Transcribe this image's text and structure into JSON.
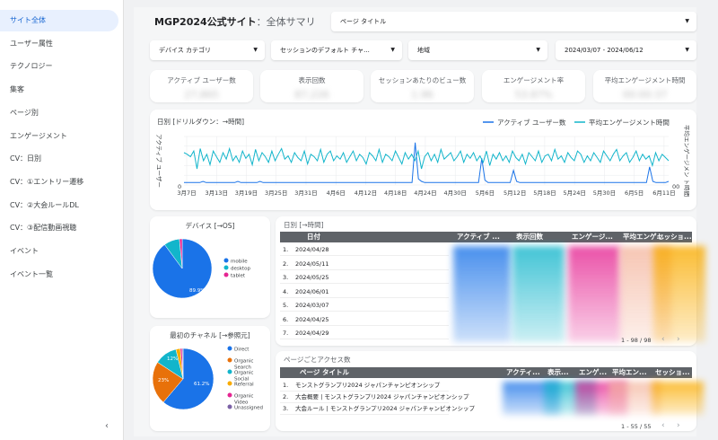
{
  "sidebar": {
    "items": [
      {
        "label": "サイト全体",
        "active": true
      },
      {
        "label": "ユーザー属性",
        "active": false
      },
      {
        "label": "テクノロジー",
        "active": false
      },
      {
        "label": "集客",
        "active": false
      },
      {
        "label": "ページ別",
        "active": false
      },
      {
        "label": "エンゲージメント",
        "active": false
      },
      {
        "label": "CV：日別",
        "active": false
      },
      {
        "label": "CV：①エントリー遷移",
        "active": false
      },
      {
        "label": "CV：②大会ルールDL",
        "active": false
      },
      {
        "label": "CV：③配信動画視聴",
        "active": false
      },
      {
        "label": "イベント",
        "active": false
      },
      {
        "label": "イベント一覧",
        "active": false
      }
    ],
    "collapse_icon": "chevron-left-icon"
  },
  "header": {
    "title": "MGP2024公式サイト",
    "subtitle": "：全体サマリ",
    "page_title_filter": "ページ タイトル"
  },
  "filters": {
    "device": "デバイス カテゴリ",
    "channel": "セッションのデフォルト チャ...",
    "region": "地域",
    "date_range": "2024/03/07 - 2024/06/12"
  },
  "kpis": [
    {
      "label": "アクティブ ユーザー数",
      "value": "27,865"
    },
    {
      "label": "表示回数",
      "value": "87,226"
    },
    {
      "label": "セッションあたりのビュー数",
      "value": "1.96"
    },
    {
      "label": "エンゲージメント率",
      "value": "53.87%"
    },
    {
      "label": "平均エンゲージメント時間",
      "value": "00:00:37"
    }
  ],
  "daily_chart": {
    "title": "日別 [ドリルダウン：→時間]",
    "y_left_label": "アクティブ ユーザー",
    "y_right_label": "平均エンゲージメン ト時間",
    "right_zero_label": "00",
    "left_zero_label": "0"
  },
  "chart_data": [
    {
      "type": "line",
      "x_ticks": [
        "3月7日",
        "3月13日",
        "3月19日",
        "3月25日",
        "3月31日",
        "4月6日",
        "4月12日",
        "4月18日",
        "4月24日",
        "4月30日",
        "5月6日",
        "5月12日",
        "5月18日",
        "5月24日",
        "5月30日",
        "6月5日",
        "6月11日"
      ],
      "grid": true,
      "legend": "top-right",
      "series": [
        {
          "name": "アクティブ ユーザー数",
          "color": "#1a73e8",
          "values": [
            2,
            2,
            2,
            2,
            2,
            2,
            3,
            2,
            2,
            2,
            2,
            2,
            2,
            2,
            2,
            2,
            2,
            3,
            2,
            2,
            2,
            2,
            2,
            2,
            3,
            2,
            2,
            2,
            2,
            2,
            2,
            2,
            2,
            2,
            2,
            2,
            2,
            2,
            2,
            2,
            2,
            2,
            2,
            2,
            2,
            2,
            2,
            2,
            2,
            2,
            2,
            2,
            2,
            2,
            2,
            2,
            2,
            2,
            2,
            2,
            2,
            2,
            2,
            2,
            2,
            2,
            2,
            2,
            2,
            2,
            2,
            2,
            2,
            35,
            5,
            3,
            2,
            2,
            2,
            2,
            2,
            2,
            2,
            2,
            2,
            2,
            2,
            2,
            2,
            2,
            2,
            2,
            2,
            2,
            22,
            4,
            2,
            2,
            2,
            2,
            2,
            2,
            2,
            2,
            12,
            3,
            2,
            2,
            2,
            2,
            2,
            2,
            2,
            2,
            2,
            2,
            2,
            2,
            2,
            2,
            2,
            2,
            2,
            2,
            2,
            2,
            2,
            2,
            2,
            2,
            2,
            2,
            2,
            2,
            2,
            2,
            2,
            2,
            2,
            2,
            2,
            2,
            2,
            2,
            2,
            2,
            2,
            15,
            3,
            2,
            2,
            2,
            2,
            3
          ]
        },
        {
          "name": "平均エンゲージメント時間",
          "color": "#12b5cb",
          "values": [
            40,
            38,
            35,
            42,
            20,
            45,
            30,
            38,
            25,
            42,
            35,
            28,
            40,
            32,
            45,
            30,
            36,
            28,
            42,
            33,
            38,
            25,
            44,
            30,
            40,
            35,
            28,
            42,
            30,
            38,
            45,
            32,
            36,
            28,
            40,
            34,
            30,
            42,
            26,
            38,
            35,
            30,
            44,
            28,
            38,
            42,
            30,
            36,
            32,
            40,
            28,
            35,
            42,
            30,
            38,
            34,
            26,
            40,
            36,
            30,
            44,
            28,
            38,
            35,
            30,
            42,
            34,
            26,
            40,
            32,
            38,
            30,
            42,
            20,
            35,
            40,
            30,
            38,
            28,
            44,
            32,
            36,
            40,
            30,
            35,
            42,
            28,
            38,
            33,
            40,
            30,
            36,
            28,
            42,
            24,
            38,
            32,
            40,
            30,
            36,
            28,
            42,
            34,
            30,
            38,
            26,
            40,
            35,
            30,
            42,
            28,
            36,
            38,
            30,
            44,
            32,
            36,
            28,
            40,
            34,
            30,
            42,
            38,
            28,
            36,
            30,
            40,
            34,
            28,
            42,
            36,
            30,
            38,
            44,
            30,
            36,
            40,
            28,
            34,
            42,
            30,
            38,
            32,
            36,
            24,
            40,
            30,
            38,
            34,
            30
          ]
        }
      ]
    },
    {
      "type": "pie",
      "title": "デバイス [→OS]",
      "legend": "right",
      "slices": [
        {
          "name": "mobile",
          "value": 89.9,
          "color": "#1a73e8"
        },
        {
          "name": "desktop",
          "value": 8.6,
          "color": "#12b5cb"
        },
        {
          "name": "tablet",
          "value": 1.5,
          "color": "#e52592"
        }
      ],
      "labels": [
        "89.9%"
      ]
    },
    {
      "type": "pie",
      "title": "最初のチャネル [→参照元]",
      "legend": "right",
      "slices": [
        {
          "name": "Direct",
          "value": 61.2,
          "color": "#1a73e8"
        },
        {
          "name": "Organic Search",
          "value": 23,
          "color": "#e8710a"
        },
        {
          "name": "Organic Social",
          "value": 12,
          "color": "#12b5cb"
        },
        {
          "name": "Referral",
          "value": 2.3,
          "color": "#f9ab00"
        },
        {
          "name": "Organic Video",
          "value": 1,
          "color": "#e52592"
        },
        {
          "name": "Unassigned",
          "value": 0.5,
          "color": "#7b61a6"
        }
      ],
      "labels": [
        "61.2%",
        "23%",
        "12%"
      ]
    }
  ],
  "daily_table": {
    "title": "日別 [→時間]",
    "headers": [
      "日付",
      "アクティブ ...",
      "表示回数",
      "エンゲージ...",
      "平均エンゲ...",
      "セッショ..."
    ],
    "rows": [
      {
        "index": "1.",
        "date": "2024/04/28"
      },
      {
        "index": "2.",
        "date": "2024/05/11"
      },
      {
        "index": "3.",
        "date": "2024/05/25"
      },
      {
        "index": "4.",
        "date": "2024/06/01"
      },
      {
        "index": "5.",
        "date": "2024/03/07"
      },
      {
        "index": "6.",
        "date": "2024/04/25"
      },
      {
        "index": "7.",
        "date": "2024/04/29"
      }
    ],
    "pager": "1 - 98 / 98"
  },
  "page_table": {
    "title": "ページごとアクセス数",
    "headers": [
      "ページ タイトル",
      "アクティ...",
      "表示...",
      "エンゲ...",
      "平均エン...",
      "セッショ..."
    ],
    "rows": [
      {
        "index": "1.",
        "title": "モンストグランプリ2024 ジャパンチャンピオンシップ"
      },
      {
        "index": "2.",
        "title": "大会概要 | モンストグランプリ2024 ジャパンチャンピオンシップ"
      },
      {
        "index": "3.",
        "title": "大会ルール | モンストグランプリ2024 ジャパンチャンピオンシップ"
      }
    ],
    "pager": "1 - 55 / 55"
  }
}
